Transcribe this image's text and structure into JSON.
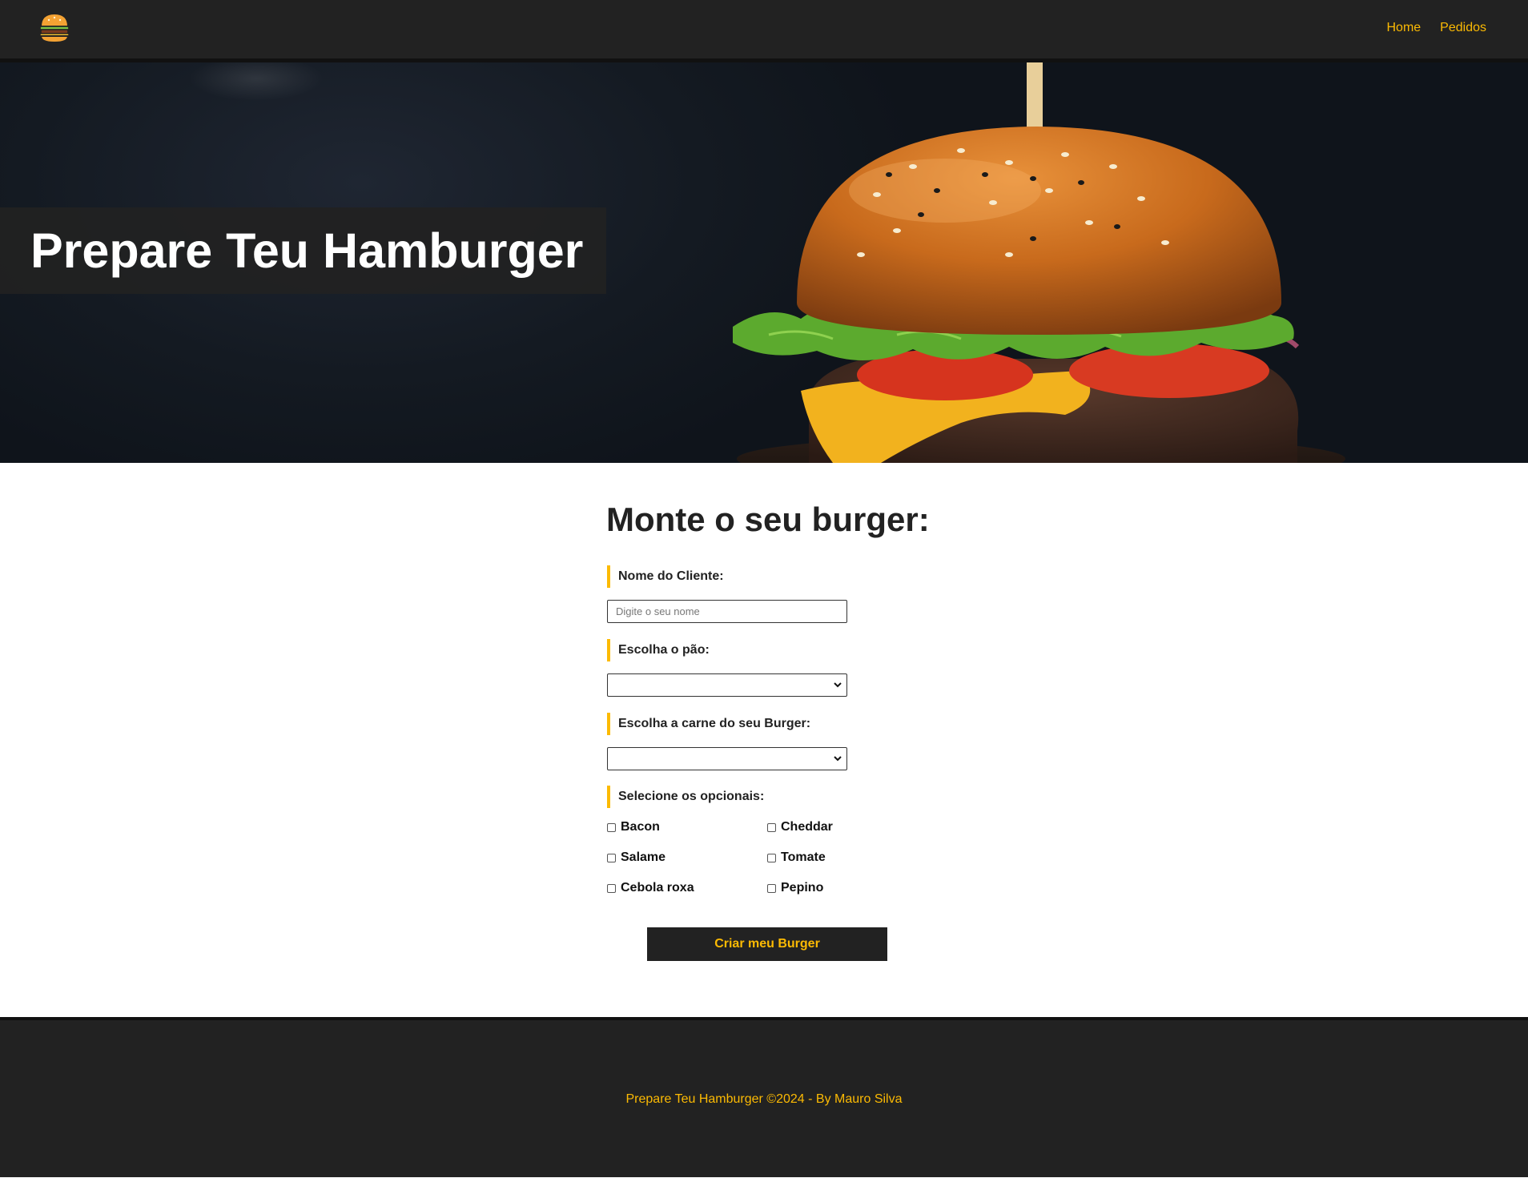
{
  "navbar": {
    "logo_icon": "burger-logo-icon",
    "links": [
      {
        "label": "Home"
      },
      {
        "label": "Pedidos"
      }
    ]
  },
  "banner": {
    "title": "Prepare Teu Hamburger"
  },
  "form": {
    "title": "Monte o seu burger:",
    "name": {
      "label": "Nome do Cliente:",
      "value": "",
      "placeholder": "Digite o seu nome"
    },
    "bread": {
      "label": "Escolha o pão:",
      "selected": ""
    },
    "meat": {
      "label": "Escolha a carne do seu Burger:",
      "selected": ""
    },
    "optionals": {
      "label": "Selecione os opcionais:",
      "items": [
        {
          "label": "Bacon",
          "checked": false
        },
        {
          "label": "Cheddar",
          "checked": false
        },
        {
          "label": "Salame",
          "checked": false
        },
        {
          "label": "Tomate",
          "checked": false
        },
        {
          "label": "Cebola roxa",
          "checked": false
        },
        {
          "label": "Pepino",
          "checked": false
        }
      ]
    },
    "submit_label": "Criar meu Burger"
  },
  "footer": {
    "text": "Prepare Teu Hamburger ©2024 - By Mauro Silva"
  },
  "colors": {
    "accent": "#fcba03",
    "dark": "#222222"
  }
}
